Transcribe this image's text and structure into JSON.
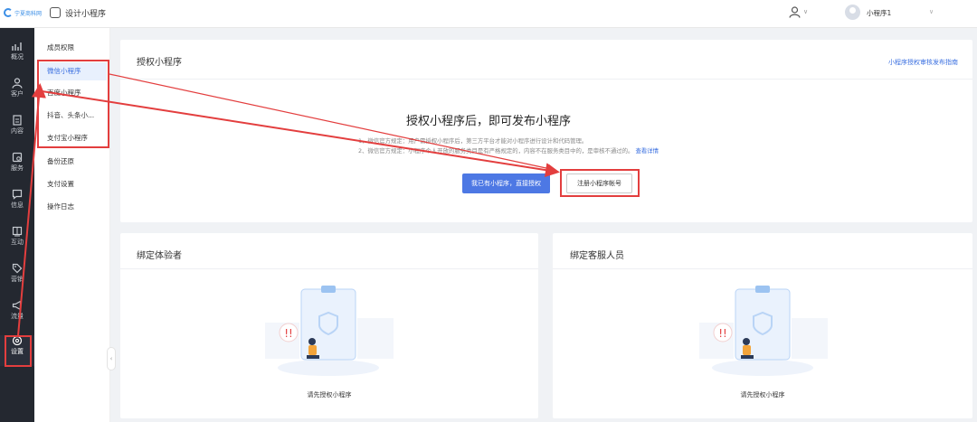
{
  "header": {
    "logo_text": "宁夏商科网",
    "app_name": "设计小程序",
    "account_name": "小程序1"
  },
  "sidebar": {
    "items": [
      {
        "label": "概况",
        "icon": "chart-icon"
      },
      {
        "label": "客户",
        "icon": "person-icon"
      },
      {
        "label": "内容",
        "icon": "document-icon"
      },
      {
        "label": "服务",
        "icon": "service-icon"
      },
      {
        "label": "信息",
        "icon": "message-icon"
      },
      {
        "label": "互动",
        "icon": "interact-icon"
      },
      {
        "label": "营销",
        "icon": "tag-icon"
      },
      {
        "label": "流量",
        "icon": "megaphone-icon"
      },
      {
        "label": "设置",
        "icon": "settings-icon"
      }
    ]
  },
  "submenu": {
    "items": [
      {
        "label": "成员权限"
      },
      {
        "label": "微信小程序"
      },
      {
        "label": "百度小程序"
      },
      {
        "label": "抖音、头条小..."
      },
      {
        "label": "支付宝小程序"
      },
      {
        "label": "备份还原"
      },
      {
        "label": "支付设置"
      },
      {
        "label": "操作日志"
      }
    ]
  },
  "authorize": {
    "title": "授权小程序",
    "guide_link": "小程序授权审核发布指南",
    "headline": "授权小程序后，即可发布小程序",
    "note1": "1、微信官方规定：用户需授权小程序后，第三方平台才能对小程序进行设计和代码管理。",
    "note2": "2、微信官方规定：小程序个人开放的服务类目是有严格规定的，内容不在服务类目中的，是审核不通过的。",
    "note2_link": "查看详情",
    "btn_primary": "我已有小程序，直接授权",
    "btn_register": "注册小程序帐号"
  },
  "testers": {
    "title": "绑定体验者",
    "empty_text": "请先授权小程序"
  },
  "service": {
    "title": "绑定客服人员",
    "empty_text": "请先授权小程序"
  },
  "colors": {
    "accent": "#4d78e4",
    "highlight": "#e33e3e",
    "sidebar_bg": "#242830"
  }
}
